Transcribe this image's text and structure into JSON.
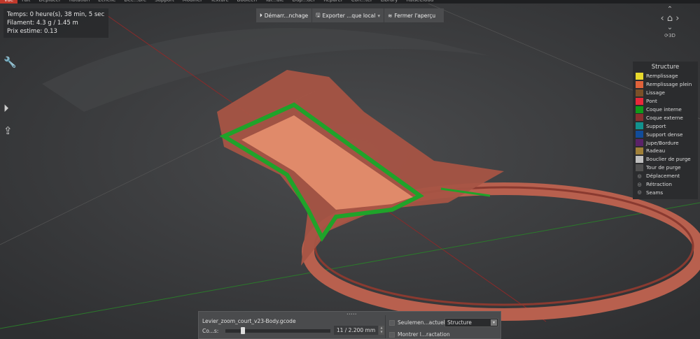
{
  "menu": [
    "Vue",
    "Fait",
    "Déplacer",
    "Rotation",
    "Echelle",
    "Déc...bre",
    "Support",
    "Modifier",
    "Texture",
    "Booléen",
    "Tai...ale",
    "Dup...uer",
    "Réparer",
    "Con...ter",
    "Library",
    "RaiseCloud"
  ],
  "info": {
    "time": "Temps: 0 heure(s), 38 min, 5 sec",
    "filament": "Filament: 4.3 g / 1.45 m",
    "price": "Prix estime: 0.13"
  },
  "toolbar": {
    "start": "Démarr...nchage",
    "export": "Exporter ...que local",
    "close": "Fermer l'aperçu"
  },
  "nav": {
    "view3d": "3D"
  },
  "legend": {
    "title": "Structure",
    "items": [
      {
        "label": "Remplissage",
        "color": "#e8d92c"
      },
      {
        "label": "Remplissage plein",
        "color": "#e0623a"
      },
      {
        "label": "Lissage",
        "color": "#7a5028"
      },
      {
        "label": "Pont",
        "color": "#e8283a"
      },
      {
        "label": "Coque interne",
        "color": "#0f9a1a"
      },
      {
        "label": "Coque externe",
        "color": "#883030"
      },
      {
        "label": "Support",
        "color": "#12928e"
      },
      {
        "label": "Support dense",
        "color": "#114c9a"
      },
      {
        "label": "Jupe/Bordure",
        "color": "#5a2268"
      },
      {
        "label": "Radeau",
        "color": "#a08038"
      },
      {
        "label": "Bouclier de purge",
        "color": "#c0c0c0"
      },
      {
        "label": "Tour de purge",
        "color": "#505050"
      }
    ],
    "toggles": [
      "Déplacement",
      "Rétraction",
      "Seams"
    ]
  },
  "bottom": {
    "file": "Levier_zoom_court_v23-Body.gcode",
    "layer_label": "Co...s:",
    "layer_value": "11 / 2.200 mm",
    "layer_fraction": 0.155,
    "only_current": "Seulemen...actuelle",
    "show_retract": "Montrer l...ractation",
    "view_mode": "Structure"
  }
}
